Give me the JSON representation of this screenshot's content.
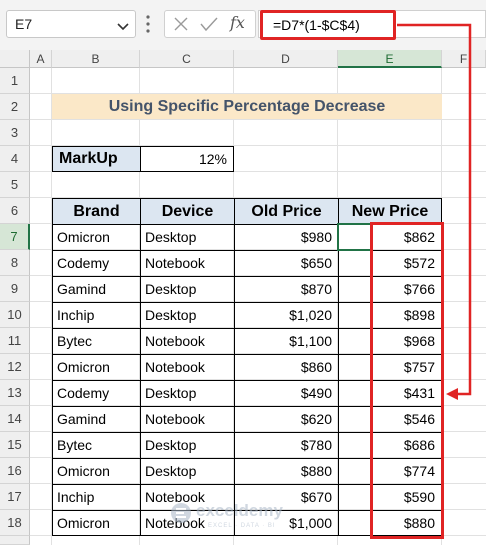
{
  "formula_bar": {
    "name_box": "E7",
    "formula": "=D7*(1-$C$4)",
    "icons": [
      "chevron-down-icon",
      "more-options-icon",
      "cancel-icon",
      "enter-icon",
      "function-icon"
    ]
  },
  "column_headers": [
    "A",
    "B",
    "C",
    "D",
    "E",
    "F"
  ],
  "row_headers": [
    "1",
    "2",
    "3",
    "4",
    "5",
    "6",
    "7",
    "8",
    "9",
    "10",
    "11",
    "12",
    "13",
    "14",
    "15",
    "16",
    "17",
    "18"
  ],
  "sheet": {
    "title": "Using Specific Percentage Decrease",
    "markup_label": "MarkUp",
    "markup_value": "12%",
    "table_headers": [
      "Brand",
      "Device",
      "Old Price",
      "New Price"
    ],
    "rows": [
      [
        "Omicron",
        "Desktop",
        "$980",
        "$862"
      ],
      [
        "Codemy",
        "Notebook",
        "$650",
        "$572"
      ],
      [
        "Gamind",
        "Desktop",
        "$870",
        "$766"
      ],
      [
        "Inchip",
        "Desktop",
        "$1,020",
        "$898"
      ],
      [
        "Bytec",
        "Notebook",
        "$1,100",
        "$968"
      ],
      [
        "Omicron",
        "Notebook",
        "$860",
        "$757"
      ],
      [
        "Codemy",
        "Desktop",
        "$490",
        "$431"
      ],
      [
        "Gamind",
        "Notebook",
        "$620",
        "$546"
      ],
      [
        "Bytec",
        "Desktop",
        "$780",
        "$686"
      ],
      [
        "Omicron",
        "Desktop",
        "$880",
        "$774"
      ],
      [
        "Inchip",
        "Notebook",
        "$670",
        "$590"
      ],
      [
        "Omicron",
        "Notebook",
        "$1,000",
        "$880"
      ]
    ]
  },
  "watermark": {
    "name": "exceldemy",
    "tagline": "EXCEL · DATA · BI"
  },
  "colors": {
    "highlight_red": "#e02424",
    "header_fill": "#dce6f1",
    "title_fill": "#fbe8c8",
    "title_text": "#44546a",
    "selection_green": "#217346"
  }
}
